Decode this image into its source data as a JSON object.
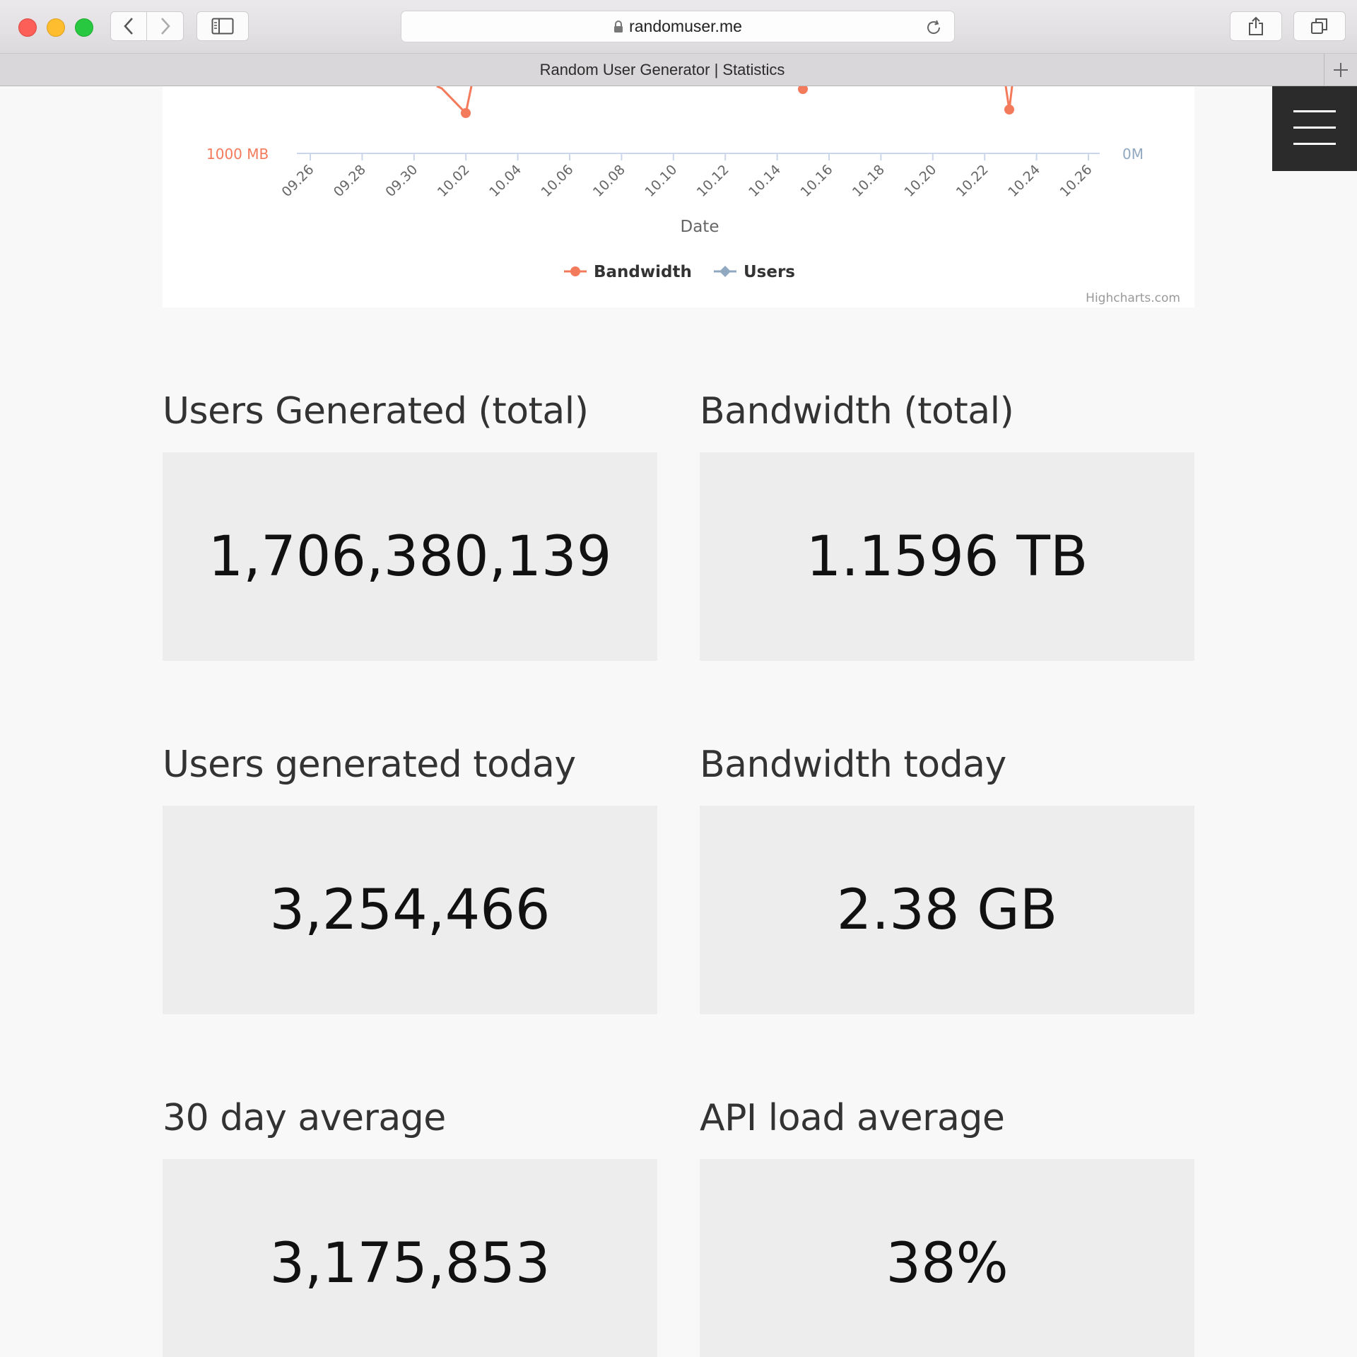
{
  "browser": {
    "url": "randomuser.me",
    "tab_title": "Random User Generator | Statistics"
  },
  "chart_data": {
    "type": "line",
    "xlabel": "Date",
    "x_ticks": [
      "09.26",
      "09.28",
      "09.30",
      "10.02",
      "10.04",
      "10.06",
      "10.08",
      "10.10",
      "10.12",
      "10.14",
      "10.16",
      "10.18",
      "10.20",
      "10.22",
      "10.24",
      "10.26"
    ],
    "left_axis_label": "1000 MB",
    "right_axis_label": "0M",
    "series": [
      {
        "name": "Bandwidth",
        "color": "#f47a5c"
      },
      {
        "name": "Users",
        "color": "#90a8c0"
      }
    ],
    "credits": "Highcharts.com"
  },
  "stats": [
    {
      "title": "Users Generated (total)",
      "value": "1,706,380,139"
    },
    {
      "title": "Bandwidth (total)",
      "value": "1.1596 TB"
    },
    {
      "title": "Users generated today",
      "value": "3,254,466"
    },
    {
      "title": "Bandwidth today",
      "value": "2.38 GB"
    },
    {
      "title": "30 day average",
      "value": "3,175,853"
    },
    {
      "title": "API load average",
      "value": "38%"
    }
  ]
}
